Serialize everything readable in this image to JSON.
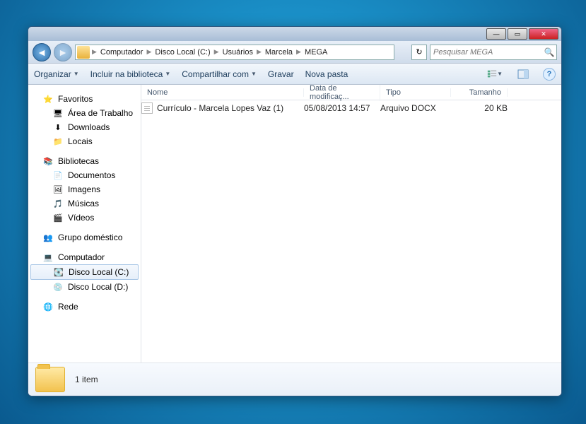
{
  "titlebar": {
    "min": "—",
    "max": "▭",
    "close": "✕"
  },
  "nav": {
    "back": "◄",
    "fwd": "►",
    "refresh": "↻",
    "crumbs": [
      "Computador",
      "Disco Local (C:)",
      "Usuários",
      "Marcela",
      "MEGA"
    ],
    "search_placeholder": "Pesquisar MEGA"
  },
  "toolbar": {
    "organize": "Organizar",
    "include": "Incluir na biblioteca",
    "share": "Compartilhar com",
    "burn": "Gravar",
    "newfolder": "Nova pasta"
  },
  "columns": {
    "name": "Nome",
    "date": "Data de modificaç...",
    "type": "Tipo",
    "size": "Tamanho"
  },
  "sidebar": {
    "favorites": "Favoritos",
    "desktop": "Área de Trabalho",
    "downloads": "Downloads",
    "places": "Locais",
    "libraries": "Bibliotecas",
    "documents": "Documentos",
    "pictures": "Imagens",
    "music": "Músicas",
    "videos": "Vídeos",
    "homegroup": "Grupo doméstico",
    "computer": "Computador",
    "disk_c": "Disco Local (C:)",
    "disk_d": "Disco Local (D:)",
    "network": "Rede"
  },
  "files": [
    {
      "name": "Currículo - Marcela Lopes Vaz (1)",
      "date": "05/08/2013 14:57",
      "type": "Arquivo DOCX",
      "size": "20 KB"
    }
  ],
  "details": {
    "count": "1 item"
  }
}
